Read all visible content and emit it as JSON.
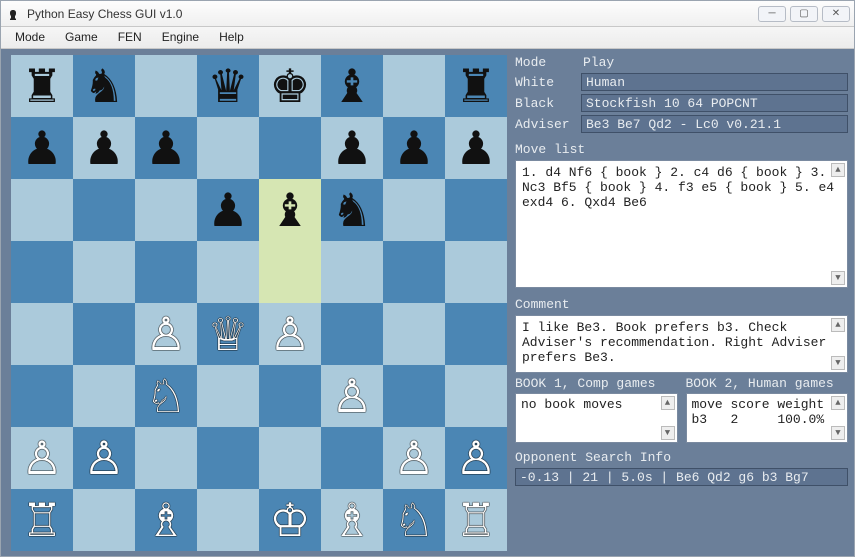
{
  "window": {
    "title": "Python Easy Chess GUI v1.0"
  },
  "menu": [
    "Mode",
    "Game",
    "FEN",
    "Engine",
    "Help"
  ],
  "info": {
    "mode_label": "Mode",
    "mode_value": "Play",
    "white_label": "White",
    "white_value": "Human",
    "black_label": "Black",
    "black_value": "Stockfish 10 64 POPCNT",
    "adviser_label": "Adviser",
    "adviser_value": "Be3 Be7 Qd2 - Lc0 v0.21.1"
  },
  "movelist": {
    "label": "Move list",
    "text": "1. d4 Nf6 { book } 2. c4 d6 { book } 3. Nc3 Bf5 { book } 4. f3 e5 { book } 5. e4 exd4 6. Qxd4 Be6"
  },
  "comment": {
    "label": "Comment",
    "text": "I like Be3. Book prefers b3. Check Adviser's recommendation. Right Adviser prefers Be3."
  },
  "book1": {
    "label": "BOOK 1, Comp games",
    "text": "no book moves"
  },
  "book2": {
    "label": "BOOK 2, Human games",
    "text": "move score weight\nb3   2     100.0%"
  },
  "search": {
    "label": "Opponent Search Info",
    "value": "-0.13 | 21 | 5.0s | Be6 Qd2 g6 b3 Bg7"
  },
  "board": {
    "highlights": [
      "e6",
      "e5"
    ],
    "pieces": {
      "a8": "r",
      "b8": "n",
      "d8": "q",
      "e8": "k",
      "f8": "b",
      "h8": "r",
      "a7": "p",
      "b7": "p",
      "c7": "p",
      "f7": "p",
      "g7": "p",
      "h7": "p",
      "d6": "p",
      "e6": "b",
      "f6": "n",
      "c4": "P",
      "d4": "Q",
      "e4": "P",
      "c3": "N",
      "f3": "P",
      "a2": "P",
      "b2": "P",
      "g2": "P",
      "h2": "P",
      "a1": "R",
      "c1": "B",
      "e1": "K",
      "f1": "B",
      "g1": "N",
      "h1": "R"
    }
  }
}
